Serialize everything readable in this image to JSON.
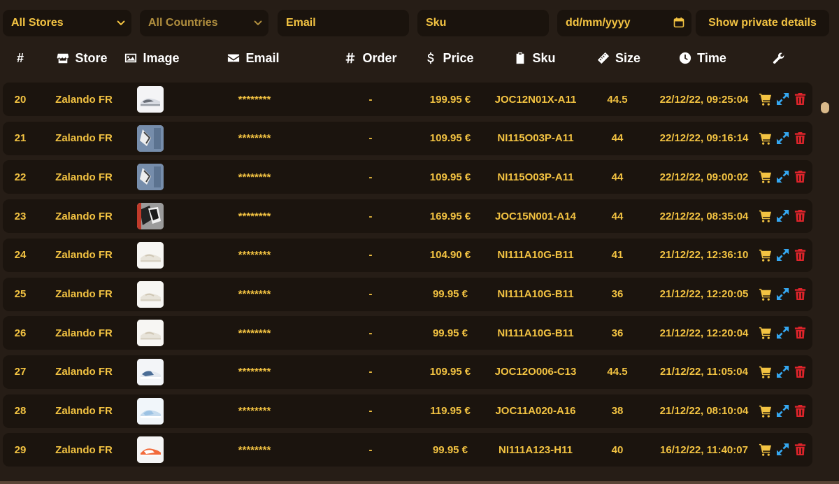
{
  "filters": {
    "store": "All Stores",
    "country": "All Countries",
    "email_placeholder": "Email",
    "sku_placeholder": "Sku",
    "date_placeholder": "dd/mm/yyyy",
    "private_button": "Show private details"
  },
  "columns": {
    "num": "#",
    "store": "Store",
    "image": "Image",
    "email": "Email",
    "order": "Order",
    "price": "Price",
    "sku": "Sku",
    "size": "Size",
    "time": "Time"
  },
  "rows": [
    {
      "id": "20",
      "store": "Zalando FR",
      "image": "grey-white-sneaker",
      "email": "********",
      "order": "-",
      "price": "199.95 €",
      "sku": "JOC12N01X-A11",
      "size": "44.5",
      "time": "22/12/22, 09:25:04"
    },
    {
      "id": "21",
      "store": "Zalando FR",
      "image": "denim-sneaker",
      "email": "********",
      "order": "-",
      "price": "109.95 €",
      "sku": "NI115O03P-A11",
      "size": "44",
      "time": "22/12/22, 09:16:14"
    },
    {
      "id": "22",
      "store": "Zalando FR",
      "image": "denim-sneaker",
      "email": "********",
      "order": "-",
      "price": "109.95 €",
      "sku": "NI115O03P-A11",
      "size": "44",
      "time": "22/12/22, 09:00:02"
    },
    {
      "id": "23",
      "store": "Zalando FR",
      "image": "black-white-sneaker",
      "email": "********",
      "order": "-",
      "price": "169.95 €",
      "sku": "JOC15N001-A14",
      "size": "44",
      "time": "22/12/22, 08:35:04"
    },
    {
      "id": "24",
      "store": "Zalando FR",
      "image": "cream-sneaker",
      "email": "********",
      "order": "-",
      "price": "104.90 €",
      "sku": "NI111A10G-B11",
      "size": "41",
      "time": "21/12/22, 12:36:10"
    },
    {
      "id": "25",
      "store": "Zalando FR",
      "image": "cream-sneaker",
      "email": "********",
      "order": "-",
      "price": "99.95 €",
      "sku": "NI111A10G-B11",
      "size": "36",
      "time": "21/12/22, 12:20:05"
    },
    {
      "id": "26",
      "store": "Zalando FR",
      "image": "cream-sneaker",
      "email": "********",
      "order": "-",
      "price": "99.95 €",
      "sku": "NI111A10G-B11",
      "size": "36",
      "time": "21/12/22, 12:20:04"
    },
    {
      "id": "27",
      "store": "Zalando FR",
      "image": "blue-sneaker",
      "email": "********",
      "order": "-",
      "price": "109.95 €",
      "sku": "JOC12O006-C13",
      "size": "44.5",
      "time": "21/12/22, 11:05:04"
    },
    {
      "id": "28",
      "store": "Zalando FR",
      "image": "light-blue-sneaker",
      "email": "********",
      "order": "-",
      "price": "119.95 €",
      "sku": "JOC11A020-A16",
      "size": "38",
      "time": "21/12/22, 08:10:04"
    },
    {
      "id": "29",
      "store": "Zalando FR",
      "image": "orange-sneaker",
      "email": "********",
      "order": "-",
      "price": "99.95 €",
      "sku": "NI111A123-H11",
      "size": "40",
      "time": "16/12/22, 11:40:07"
    }
  ],
  "icons": {
    "store": "store-icon",
    "image": "image-icon",
    "email": "envelope-icon",
    "order": "hash-icon",
    "price": "dollar-icon",
    "sku": "clipboard-icon",
    "size": "ruler-icon",
    "time": "clock-icon",
    "actions": "wrench-icon",
    "row_actions": [
      "cart-icon",
      "expand-icon",
      "trash-icon"
    ]
  },
  "colors": {
    "accent": "#f3c342",
    "cart": "#f3c342",
    "expand": "#35a7f0",
    "delete": "#e0242b",
    "row_bg": "#1b140e",
    "page_bg": "#261d16"
  }
}
